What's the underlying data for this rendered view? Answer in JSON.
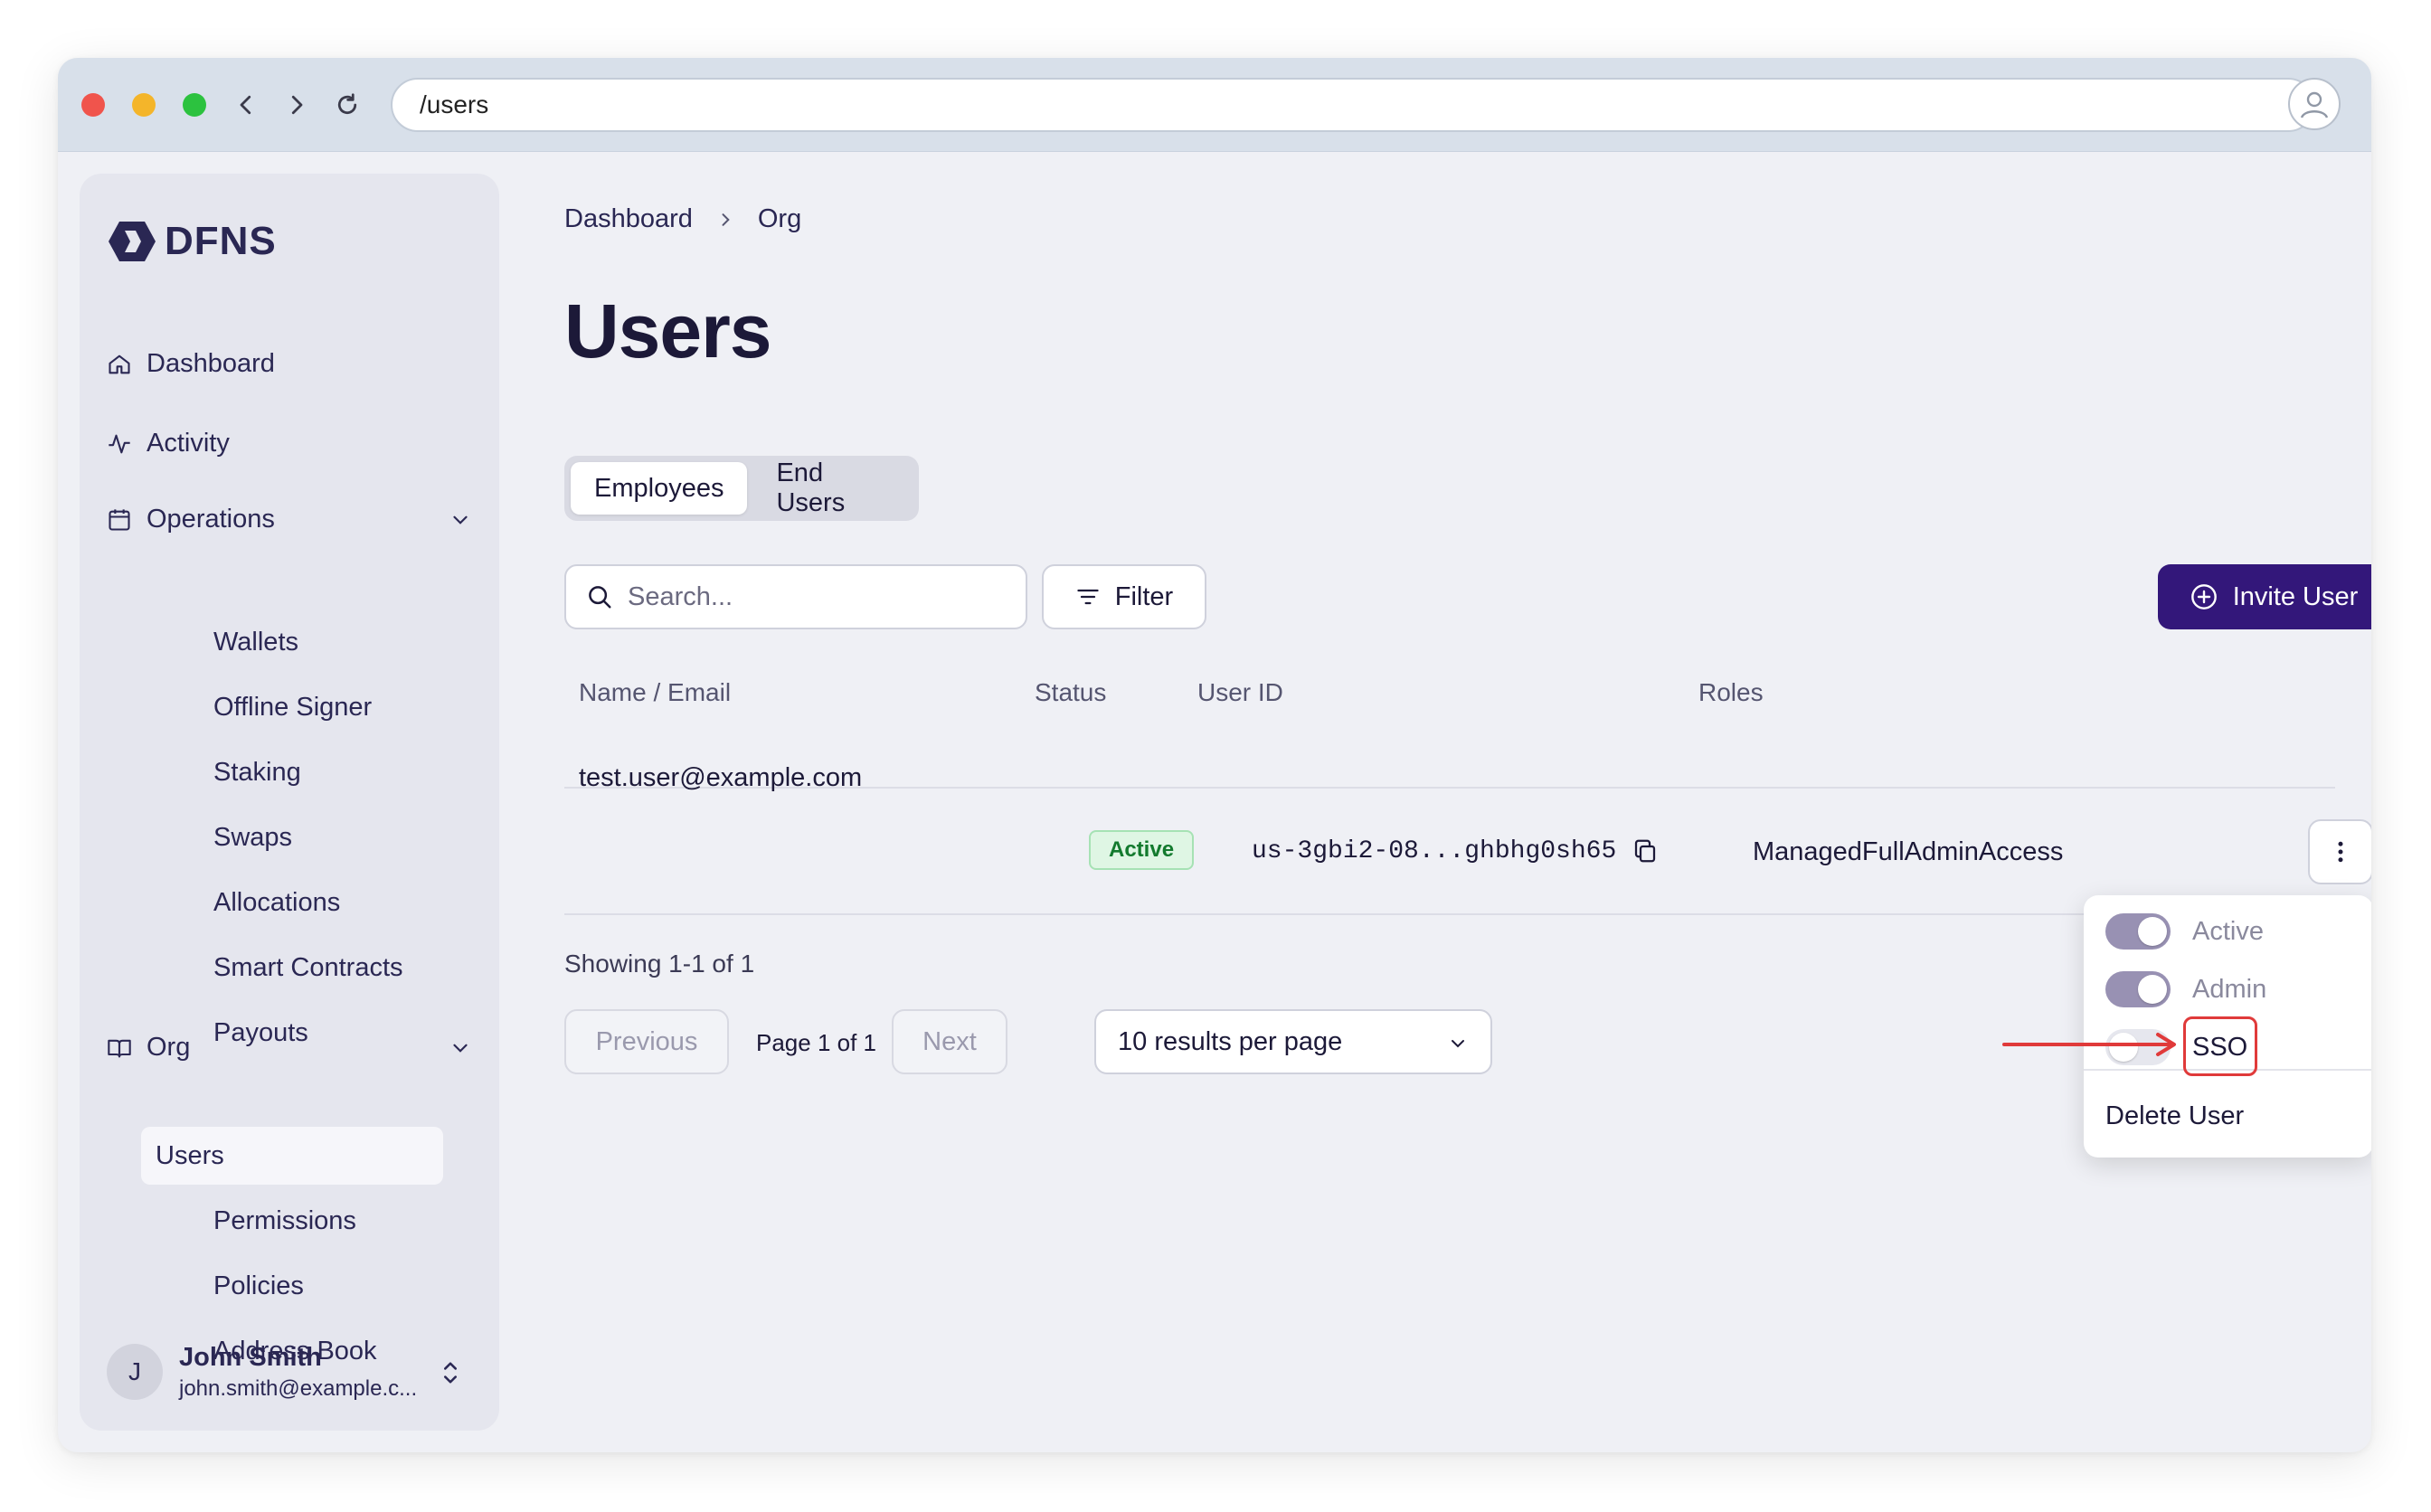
{
  "browser": {
    "url": "/users"
  },
  "sidebar": {
    "logo_text": "DFNS",
    "items": [
      {
        "label": "Dashboard",
        "icon": "home-icon"
      },
      {
        "label": "Activity",
        "icon": "activity-icon"
      },
      {
        "label": "Operations",
        "icon": "calendar-icon",
        "expanded": true
      },
      {
        "label": "Org",
        "icon": "book-icon",
        "expanded": true
      }
    ],
    "operations_items": [
      "Wallets",
      "Offline Signer",
      "Staking",
      "Swaps",
      "Allocations",
      "Smart Contracts",
      "Payouts"
    ],
    "org_items": [
      "Users",
      "Permissions",
      "Policies",
      "Address Book"
    ],
    "active_item": "Users",
    "user": {
      "initial": "J",
      "name": "John Smith",
      "email": "john.smith@example.c..."
    }
  },
  "main": {
    "breadcrumb": [
      "Dashboard",
      "Org"
    ],
    "title": "Users",
    "tabs": [
      {
        "label": "Employees",
        "active": true
      },
      {
        "label": "End Users",
        "active": false
      }
    ],
    "search_placeholder": "Search...",
    "filter_label": "Filter",
    "invite_label": "Invite User",
    "table": {
      "headers": [
        "Name / Email",
        "Status",
        "User ID",
        "Roles"
      ],
      "rows": [
        {
          "email": "test.user@example.com",
          "status": "Active",
          "user_id": "us-3gbi2-08...ghbhg0sh65",
          "roles": "ManagedFullAdminAccess"
        }
      ]
    },
    "showing": "Showing 1-1 of 1",
    "pagination": {
      "previous": "Previous",
      "page_text": "Page 1 of 1",
      "next": "Next",
      "per_page": "10 results per page"
    }
  },
  "row_menu": {
    "toggles": [
      {
        "label": "Active",
        "on": true
      },
      {
        "label": "Admin",
        "on": true
      },
      {
        "label": "SSO",
        "on": false,
        "highlighted": true
      }
    ],
    "delete_label": "Delete User"
  },
  "colors": {
    "accent": "#33177a",
    "status_active_bg": "#dff6e4",
    "status_active_text": "#137a2e",
    "highlight": "#e03a3a"
  }
}
